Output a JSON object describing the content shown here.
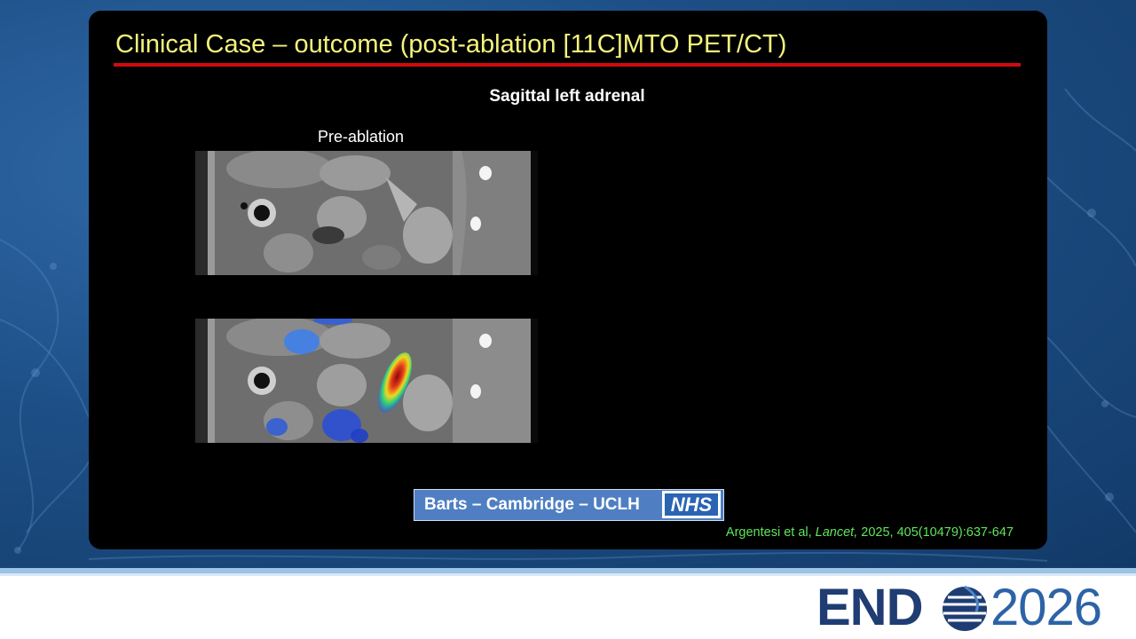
{
  "slide": {
    "title": "Clinical Case – outcome (post-ablation [11C]MTO PET/CT)",
    "subtitle": "Sagittal left adrenal",
    "panel_label": "Pre-ablation",
    "images": [
      {
        "name": "ct-sagittal-pre-ablation",
        "modality": "CT"
      },
      {
        "name": "pet-ct-sagittal-pre-ablation",
        "modality": "PET/CT fusion"
      }
    ],
    "banner": {
      "text": "Barts – Cambridge – UCLH",
      "logo_text": "NHS"
    },
    "citation": {
      "authors": "Argentesi et al, ",
      "journal": "Lancet,",
      "details": " 2025, 405(10479):637-647"
    }
  },
  "footer": {
    "logo_word": "END",
    "logo_year": "2026"
  },
  "colors": {
    "title": "#f4f37c",
    "title_rule": "#d10a10",
    "citation": "#5ee65a",
    "banner": "#4f7fc2",
    "nhs_blue": "#2a64b3"
  }
}
